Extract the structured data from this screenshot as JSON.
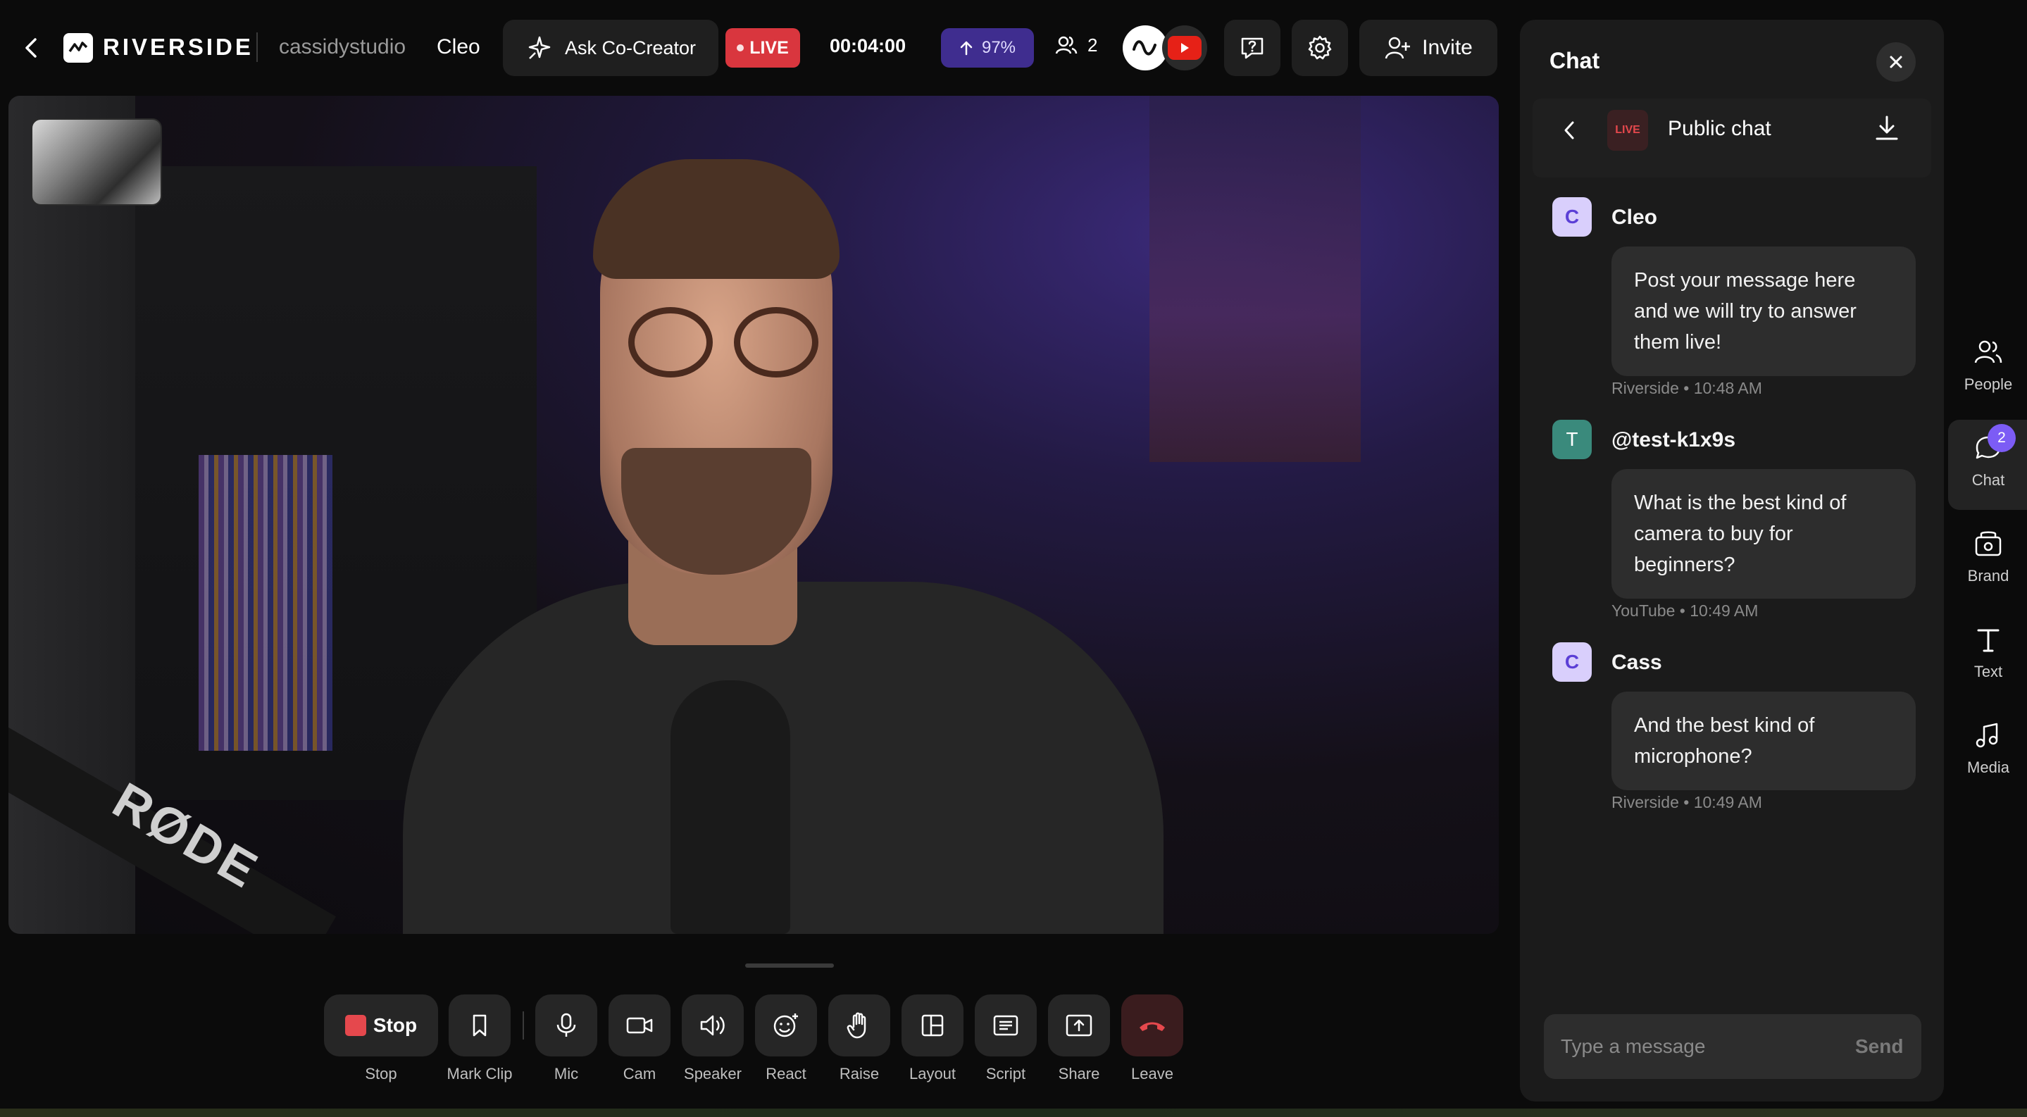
{
  "header": {
    "brand": "RIVERSIDE",
    "workspace": "cassidystudio",
    "studio": "Cleo",
    "ask_cocreator": "Ask Co-Creator",
    "live_label": "LIVE",
    "timer": "00:04:00",
    "upload_progress": "97%",
    "participants_count": "2",
    "invite": "Invite"
  },
  "controls": [
    {
      "label": "Stop",
      "button_text": "Stop"
    },
    {
      "label": "Mark Clip"
    },
    {
      "label": "Mic"
    },
    {
      "label": "Cam"
    },
    {
      "label": "Speaker"
    },
    {
      "label": "React"
    },
    {
      "label": "Raise"
    },
    {
      "label": "Layout"
    },
    {
      "label": "Script"
    },
    {
      "label": "Share"
    },
    {
      "label": "Leave"
    }
  ],
  "chat": {
    "title": "Chat",
    "channel_badge": "LIVE",
    "channel_name": "Public chat",
    "messages": [
      {
        "avatar": "C",
        "author": "Cleo",
        "text": "Post your message here and we will try to answer them live!",
        "source": "Riverside",
        "time": "10:48 AM"
      },
      {
        "avatar": "T",
        "author": "@test-k1x9s",
        "text": "What is the best kind of camera to buy for beginners?",
        "source": "YouTube",
        "time": "10:49 AM"
      },
      {
        "avatar": "C",
        "author": "Cass",
        "text": "And the best kind of microphone?",
        "source": "Riverside",
        "time": "10:49 AM"
      }
    ],
    "input_placeholder": "Type a message",
    "send": "Send"
  },
  "rail": [
    {
      "label": "People",
      "icon": "people-icon"
    },
    {
      "label": "Chat",
      "icon": "chat-icon",
      "badge": "2"
    },
    {
      "label": "Brand",
      "icon": "brand-icon"
    },
    {
      "label": "Text",
      "icon": "text-icon"
    },
    {
      "label": "Media",
      "icon": "music-icon"
    }
  ],
  "colors": {
    "live_red": "#d9363e",
    "accent_purple": "#5b3fd6",
    "chat_bg": "#1b1b1b",
    "bubble_bg": "#2d2d2d"
  }
}
